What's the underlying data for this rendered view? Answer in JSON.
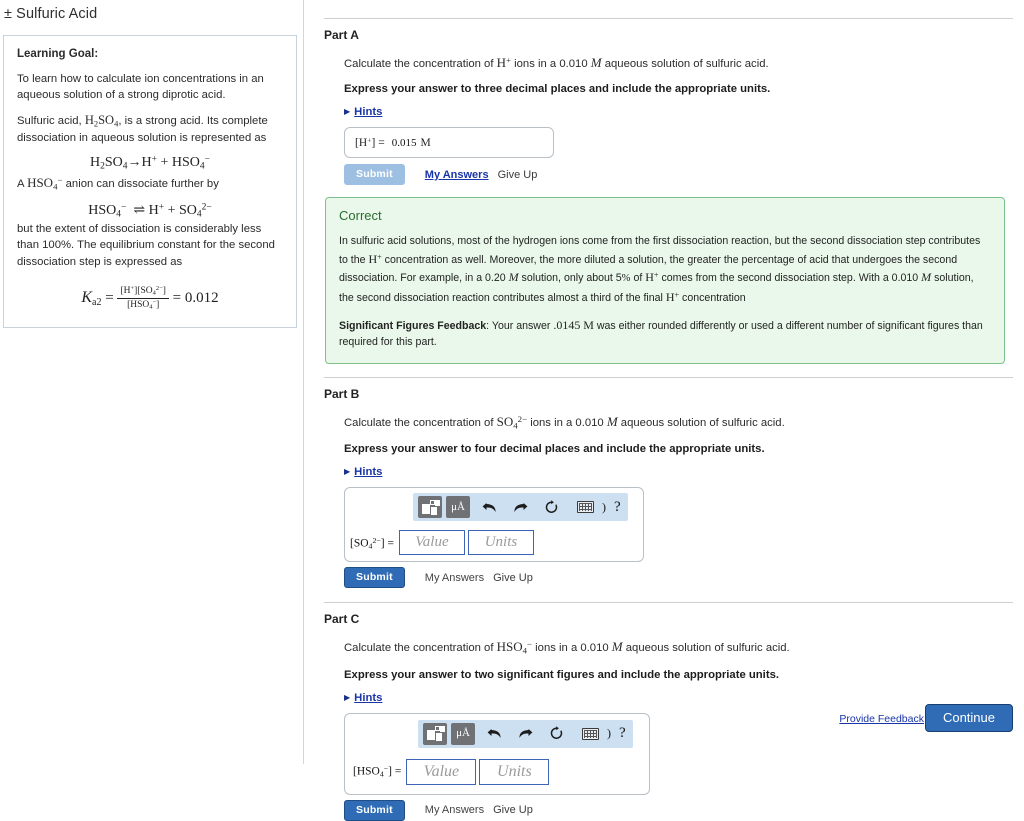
{
  "sidebar": {
    "problem_title": "± Sulfuric Acid",
    "goal_heading": "Learning Goal:",
    "goal_text": "To learn how to calculate ion concentrations in an aqueous solution of a strong diprotic acid.",
    "intro_pre": "Sulfuric acid, ",
    "intro_formula": "H2SO4",
    "intro_post": ", is a strong acid. Its complete dissociation in aqueous solution is represented as",
    "equation_1": "H2SO4 → H+ + HSO4−",
    "mid_pre": "A ",
    "mid_formula": "HSO4−",
    "mid_post": " anion can dissociate further by",
    "equation_2": "HSO4− ⇌ H+ + SO4 2−",
    "tail_text": "but the extent of dissociation is considerably less than 100%. The equilibrium constant for the second dissociation step is expressed as",
    "equation_3": "Ka2 = [H+][SO4 2−] / [HSO4−] = 0.012",
    "ka_symbol": "K",
    "ka_sub": "a2",
    "ka_num": "[H+][SO4 2−]",
    "ka_den": "[HSO4−]",
    "ka_value": "0.012"
  },
  "parts": [
    {
      "header": "Part A",
      "question_pre": "Calculate the concentration of ",
      "question_ion": "H+",
      "question_mid": " ions in a 0.010 ",
      "question_unit": "M",
      "question_post": " aqueous solution of sulfuric acid.",
      "instruction": "Express your answer to three decimal places and include the appropriate units.",
      "hints_label": "Hints",
      "answered": true,
      "answer_lhs": "[H+] =",
      "answer_value": "0.015",
      "answer_units": "M",
      "submit_label": "Submit",
      "submit_state": "disabled",
      "my_answers_label": "My Answers",
      "give_up_label": "Give Up",
      "feedback": {
        "title": "Correct",
        "paragraph_1": "In sulfuric acid solutions, most of the hydrogen ions come from the first dissociation reaction, but the second dissociation step contributes to the H+ concentration as well. Moreover, the more diluted a solution, the greater the percentage of acid that undergoes the second dissociation. For example, in a 0.20 M solution, only about 5% of H+ comes from the second dissociation step. With a 0.010 M solution, the second dissociation reaction contributes almost a third of the final H+ concentration",
        "sigfig_label": "Significant Figures Feedback",
        "sigfig_text_pre": ": Your answer ",
        "sigfig_value": ".0145",
        "sigfig_unit": "M",
        "sigfig_text_post": " was either rounded differently or used a different number of significant figures than required for this part."
      }
    },
    {
      "header": "Part B",
      "question_pre": "Calculate the concentration of ",
      "question_ion": "SO4 2−",
      "question_mid": " ions in a 0.010 ",
      "question_unit": "M",
      "question_post": " aqueous solution of sulfuric acid.",
      "instruction": "Express your answer to four decimal places and include the appropriate units.",
      "hints_label": "Hints",
      "answered": false,
      "answer_lhs": "[SO4 2−] =",
      "value_placeholder": "Value",
      "units_placeholder": "Units",
      "submit_label": "Submit",
      "submit_state": "primary",
      "my_answers_label": "My Answers",
      "give_up_label": "Give Up"
    },
    {
      "header": "Part C",
      "question_pre": "Calculate the concentration of ",
      "question_ion": "HSO4−",
      "question_mid": " ions in a 0.010 ",
      "question_unit": "M",
      "question_post": " aqueous solution of sulfuric acid.",
      "instruction": "Express your answer to two significant figures and include the appropriate units.",
      "hints_label": "Hints",
      "answered": false,
      "answer_lhs": "[HSO4−] =",
      "value_placeholder": "Value",
      "units_placeholder": "Units",
      "submit_label": "Submit",
      "submit_state": "primary",
      "my_answers_label": "My Answers",
      "give_up_label": "Give Up"
    }
  ],
  "toolbar": {
    "template_icon": "math-template-icon",
    "units_icon": "μÅ",
    "undo_icon": "undo-arrow",
    "redo_icon": "redo-arrow",
    "reset_icon": "reset-circular-arrow",
    "keyboard_icon": "keyboard",
    "paren_label": ")",
    "help_label": "?"
  },
  "footer": {
    "provide_feedback_label": "Provide Feedback",
    "continue_label": "Continue"
  },
  "colors": {
    "primary_button": "#2f6cb5",
    "disabled_button": "#9dc0e2",
    "link": "#1a35a8",
    "correct_bg": "#e9f8ea",
    "correct_border": "#7fc18a",
    "correct_title": "#2a6b2f",
    "toolbar_bg": "#cde0f2",
    "field_border": "#3f63b5"
  }
}
